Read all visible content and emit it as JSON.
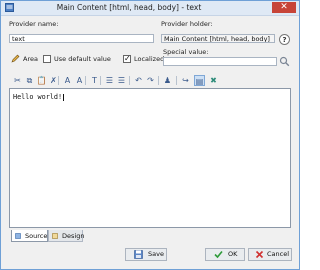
{
  "window": {
    "title": "Main Content [html, head, body] - text",
    "close_symbol": "✕"
  },
  "form": {
    "provider_name_label": "Provider name:",
    "provider_name_value": "text",
    "provider_holder_label": "Provider holder:",
    "provider_holder_value": "Main Content [html, head, body]",
    "help_symbol": "?",
    "area_label": "Area",
    "use_default_label": "Use default value",
    "use_default_checked": false,
    "localized_label": "Localized",
    "localized_checked": true,
    "special_value_label": "Special value:",
    "special_value_value": ""
  },
  "toolbar": {
    "buttons": [
      {
        "name": "cut-icon",
        "glyph": "✂"
      },
      {
        "name": "copy-icon",
        "glyph": "⧉"
      },
      {
        "name": "paste-icon",
        "glyph": "📋"
      },
      {
        "name": "delete-icon",
        "glyph": "✗"
      },
      {
        "name": "find-icon",
        "glyph": "A"
      },
      {
        "name": "replace-icon",
        "glyph": "A"
      },
      {
        "name": "format-icon",
        "glyph": "T"
      },
      {
        "name": "indent-icon",
        "glyph": "☰"
      },
      {
        "name": "outdent-icon",
        "glyph": "☰"
      },
      {
        "name": "undo-icon",
        "glyph": "↶"
      },
      {
        "name": "redo-icon",
        "glyph": "↷"
      },
      {
        "name": "users-icon",
        "glyph": "♟"
      },
      {
        "name": "insert-icon",
        "glyph": "↪"
      },
      {
        "name": "view-code-icon",
        "glyph": "▤"
      },
      {
        "name": "clear-icon",
        "glyph": "✖"
      }
    ]
  },
  "editor": {
    "text": "Hello world!"
  },
  "tabs": {
    "source_label": "Source",
    "design_label": "Design"
  },
  "buttons": {
    "save_label": "Save",
    "ok_label": "OK",
    "cancel_label": "Cancel"
  },
  "colors": {
    "accent": "#3a7bd5",
    "close": "#c74438",
    "ok_green": "#2e9b3a",
    "cancel_red": "#d03030"
  }
}
